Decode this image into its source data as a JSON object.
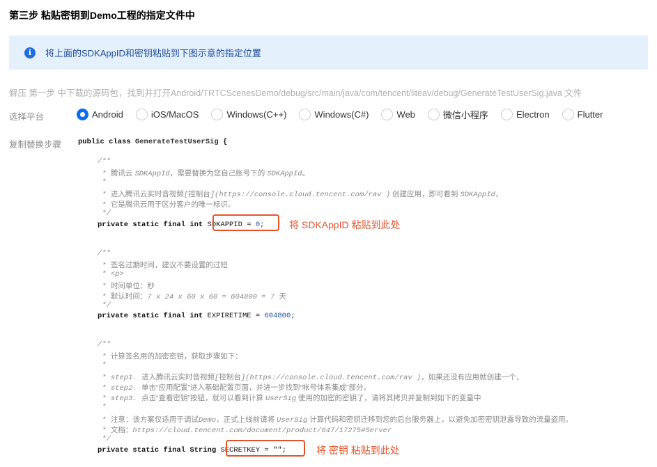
{
  "title": "第三步 粘贴密钥到Demo工程的指定文件中",
  "notice": {
    "icon": "info-icon",
    "text": "将上面的SDKAppID和密钥粘贴到下图示意的指定位置"
  },
  "path_hint": "解压 第一步 中下载的源码包，找到并打开Android/TRTCScenesDemo/debug/src/main/java/com/tencent/liteav/debug/GenerateTestUserSig.java 文件",
  "platform_label": "选择平台",
  "platforms": [
    {
      "label": "Android",
      "selected": true
    },
    {
      "label": "iOS/MacOS",
      "selected": false
    },
    {
      "label": "Windows(C++)",
      "selected": false
    },
    {
      "label": "Windows(C#)",
      "selected": false
    },
    {
      "label": "Web",
      "selected": false
    },
    {
      "label": "微信小程序",
      "selected": false
    },
    {
      "label": "Electron",
      "selected": false
    },
    {
      "label": "Flutter",
      "selected": false
    }
  ],
  "steps_label": "复制替换步骤",
  "code": {
    "class_line": {
      "kw": "public class ",
      "name": "GenerateTestUserSig",
      "rest": " {"
    },
    "c1": {
      "l1": "/**",
      "l2a": " * ",
      "l2b": "腾讯云 ",
      "l2c": "SDKAppId",
      "l2d": "，需要替换为您自己账号下的 ",
      "l2e": "SDKAppId",
      "l2f": "。",
      "l3": " *",
      "l4a": " * ",
      "l4b": "进入腾讯云实时音视频",
      "l4c": "[",
      "l4d": "控制台",
      "l4e": "](https://console.cloud.tencent.com/rav )",
      "l4f": " 创建应用，即可看到 ",
      "l4g": "SDKAppId",
      "l4h": "，",
      "l5a": " * ",
      "l5b": "它是腾讯云用于区分客户的唯一标识。",
      "l6": " */"
    },
    "sdkappid_line": {
      "kw": "private static final int ",
      "boxed": "SDKAPPID = ",
      "num": "0",
      "end": ";"
    },
    "anno1": "将 SDKAppID 粘贴到此处",
    "c2": {
      "l1": "/**",
      "l2a": " * ",
      "l2b": "签名过期时间，建议不要设置的过短",
      "l3": " * <p>",
      "l4a": " * ",
      "l4b": "时间单位：秒",
      "l5a": " * ",
      "l5b": "默认时间：",
      "l5c": "7 x 24 x 60 x 60 = 604800 = 7 ",
      "l5d": "天",
      "l6": " */"
    },
    "expire_line": {
      "kw": "private static final int ",
      "name": "EXPIRETIME = ",
      "num": "604800",
      "end": ";"
    },
    "c3": {
      "l1": "/**",
      "l2a": " * ",
      "l2b": "计算签名用的加密密钥，获取步骤如下：",
      "l3": " *",
      "l4a": " * step1. ",
      "l4b": "进入腾讯云实时音视频",
      "l4c": "[",
      "l4d": "控制台",
      "l4e": "](https://console.cloud.tencent.com/rav )",
      "l4f": "，如果还没有应用就创建一个，",
      "l5a": " * step2. ",
      "l5b": "单击“应用配置”进入基础配置页面，并进一步找到“帐号体系集成”部分。",
      "l6a": " * step3. ",
      "l6b": "点击“查看密钥”按钮，就可以看到计算 ",
      "l6c": "UserSig",
      "l6d": " 使用的加密的密钥了，请将其拷贝并复制到如下的变量中",
      "l7": " *",
      "l8a": " * ",
      "l8b": "注意：该方案仅适用于调试",
      "l8c": "Demo",
      "l8d": "，正式上线前请将 ",
      "l8e": "UserSig",
      "l8f": " 计算代码和密钥迁移到您的后台服务器上，以避免加密密钥泄露导致的流量盗用。",
      "l9a": " * ",
      "l9b": "文档：",
      "l9c": "https://cloud.tencent.com/document/product/647/17275#Server",
      "l10": " */"
    },
    "secret_line": {
      "kw": "private static final String ",
      "boxed": "SECRETKEY = \"\";"
    },
    "anno2": "将 密钥 粘贴到此处"
  },
  "colors": {
    "accent": "#0a6cf0",
    "highlight": "#e3532b",
    "notice_bg": "#e5f0fd"
  }
}
